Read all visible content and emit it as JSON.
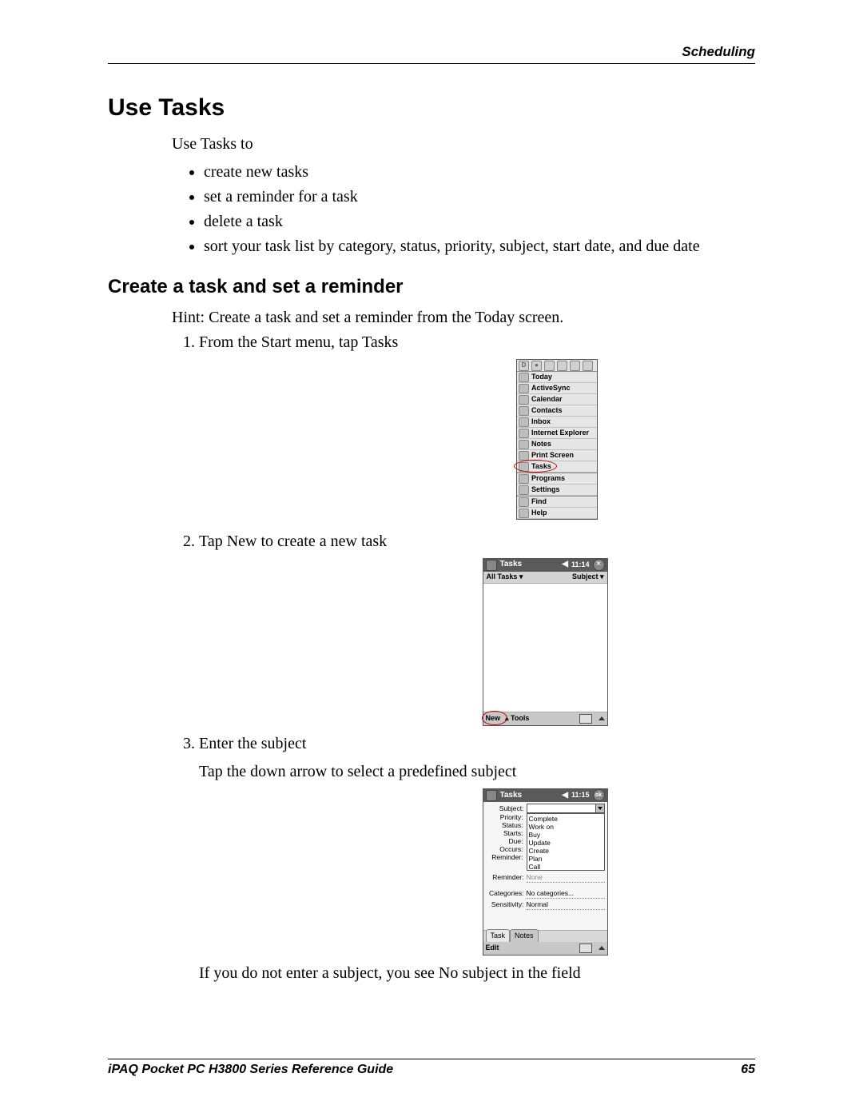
{
  "running_head": "Scheduling",
  "section_title": "Use Tasks",
  "intro": "Use Tasks to",
  "intro_bullets": [
    "create new tasks",
    "set a reminder for a task",
    "delete a task",
    "sort your task list by category, status, priority, subject, start date, and due date"
  ],
  "subsection_title": "Create a task and set a reminder",
  "hint": "Hint: Create a task and set a reminder from the Today screen.",
  "steps": {
    "s1": "From the Start menu, tap Tasks",
    "s2": "Tap New to create a new task",
    "s3": "Enter the subject",
    "s3_extra": "Tap the down arrow to select a predefined subject",
    "s3_after": "If you do not enter a subject, you see No subject in the field"
  },
  "start_menu": {
    "items": [
      "Today",
      "ActiveSync",
      "Calendar",
      "Contacts",
      "Inbox",
      "Internet Explorer",
      "Notes",
      "Print Screen",
      "Tasks",
      "Programs",
      "Settings",
      "Find",
      "Help"
    ]
  },
  "tasks_screen": {
    "title": "Tasks",
    "clock": "11:14",
    "ok_glyph": "✕",
    "filter_left": "All Tasks ▾",
    "filter_right": "Subject ▾",
    "foot_new": "New",
    "foot_tools": "Tools"
  },
  "subject_screen": {
    "title": "Tasks",
    "clock": "11:15",
    "ok_glyph": "ok",
    "labels": {
      "subject": "Subject:",
      "priority": "Priority:",
      "status": "Status:",
      "starts": "Starts:",
      "due": "Due:",
      "occurs": "Occurs:",
      "reminder": "Reminder:",
      "categories": "Categories:",
      "sensitivity": "Sensitivity:"
    },
    "dropdown_options": [
      "Complete",
      "Work on",
      "Buy",
      "Update",
      "Create",
      "Plan",
      "Call"
    ],
    "values": {
      "categories": "No categories...",
      "sensitivity": "Normal",
      "reminder": "None"
    },
    "tabs": {
      "task": "Task",
      "notes": "Notes"
    },
    "foot": "Edit"
  },
  "footer": {
    "left": "iPAQ Pocket PC H3800 Series Reference Guide",
    "right": "65"
  }
}
